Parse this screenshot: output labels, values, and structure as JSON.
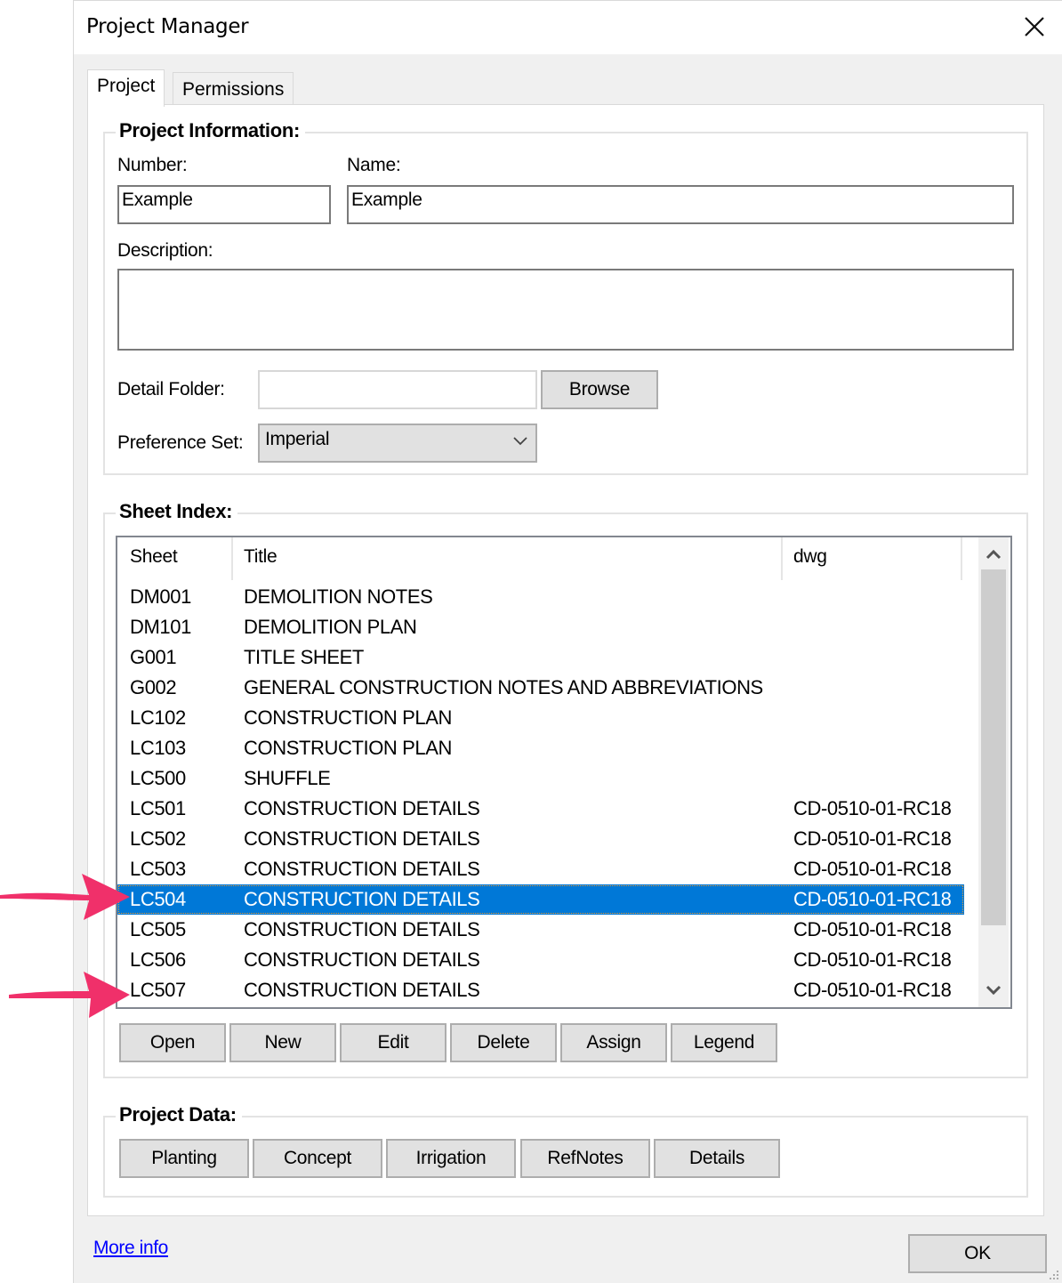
{
  "window": {
    "title": "Project Manager",
    "close_icon": "close-icon"
  },
  "tabs": [
    {
      "label": "Project",
      "active": true
    },
    {
      "label": "Permissions",
      "active": false
    }
  ],
  "project_information": {
    "group_title": "Project Information:",
    "number_label": "Number:",
    "number_value": "Example",
    "name_label": "Name:",
    "name_value": "Example",
    "description_label": "Description:",
    "description_value": "",
    "detail_folder_label": "Detail Folder:",
    "detail_folder_value": "",
    "browse_label": "Browse",
    "preference_set_label": "Preference Set:",
    "preference_set_value": "Imperial"
  },
  "sheet_index": {
    "group_title": "Sheet Index:",
    "columns": [
      "Sheet",
      "Title",
      "dwg"
    ],
    "rows": [
      {
        "sheet": "DM001",
        "title": "DEMOLITION NOTES",
        "dwg": ""
      },
      {
        "sheet": "DM101",
        "title": "DEMOLITION PLAN",
        "dwg": ""
      },
      {
        "sheet": "G001",
        "title": "TITLE SHEET",
        "dwg": ""
      },
      {
        "sheet": "G002",
        "title": "GENERAL CONSTRUCTION NOTES AND ABBREVIATIONS",
        "dwg": ""
      },
      {
        "sheet": "LC102",
        "title": "CONSTRUCTION PLAN",
        "dwg": ""
      },
      {
        "sheet": "LC103",
        "title": "CONSTRUCTION PLAN",
        "dwg": ""
      },
      {
        "sheet": "LC500",
        "title": "SHUFFLE",
        "dwg": ""
      },
      {
        "sheet": "LC501",
        "title": "CONSTRUCTION DETAILS",
        "dwg": "CD-0510-01-RC18"
      },
      {
        "sheet": "LC502",
        "title": "CONSTRUCTION DETAILS",
        "dwg": "CD-0510-01-RC18"
      },
      {
        "sheet": "LC503",
        "title": "CONSTRUCTION DETAILS",
        "dwg": "CD-0510-01-RC18"
      },
      {
        "sheet": "LC504",
        "title": "CONSTRUCTION DETAILS",
        "dwg": "CD-0510-01-RC18",
        "selected": true
      },
      {
        "sheet": "LC505",
        "title": "CONSTRUCTION DETAILS",
        "dwg": "CD-0510-01-RC18"
      },
      {
        "sheet": "LC506",
        "title": "CONSTRUCTION DETAILS",
        "dwg": "CD-0510-01-RC18"
      },
      {
        "sheet": "LC507",
        "title": "CONSTRUCTION DETAILS",
        "dwg": "CD-0510-01-RC18"
      }
    ],
    "buttons": [
      "Open",
      "New",
      "Edit",
      "Delete",
      "Assign",
      "Legend"
    ]
  },
  "project_data": {
    "group_title": "Project Data:",
    "buttons": [
      "Planting",
      "Concept",
      "Irrigation",
      "RefNotes",
      "Details"
    ]
  },
  "footer": {
    "more_info_label": "More info",
    "ok_label": "OK"
  },
  "annotations": {
    "arrow_color": "#f0306a",
    "arrows_point_to": [
      "LC504",
      "LC507"
    ]
  },
  "colors": {
    "selection": "#0078d7",
    "link": "#0000ff"
  }
}
